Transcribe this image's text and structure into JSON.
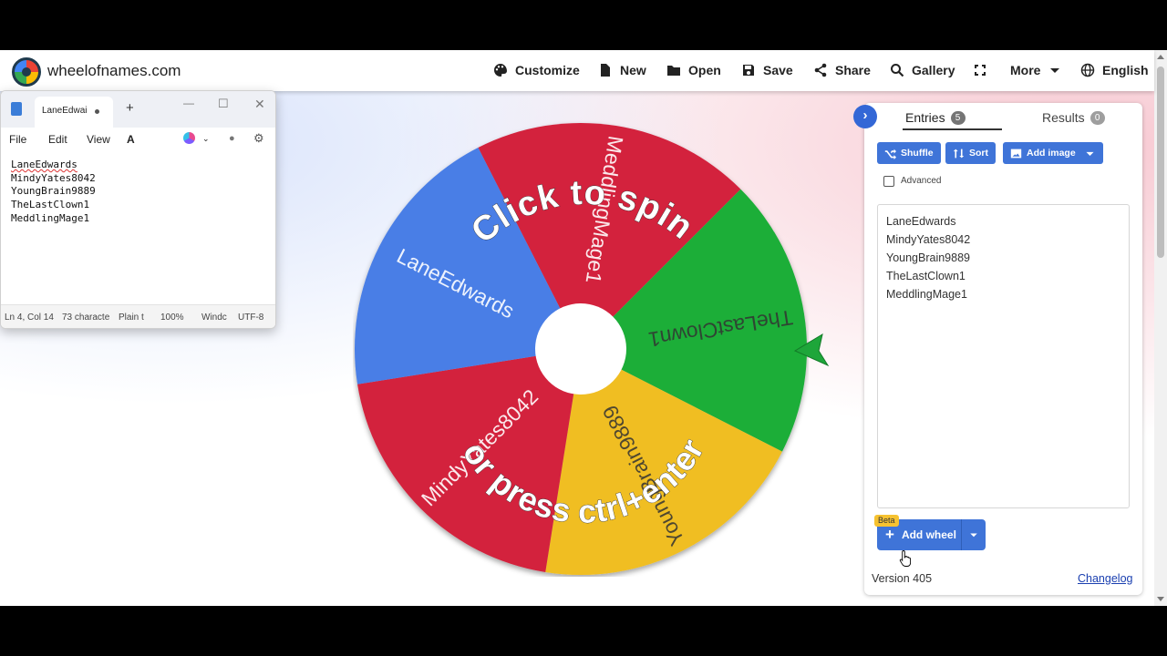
{
  "site": {
    "name": "wheelofnames.com"
  },
  "nav": [
    {
      "id": "customize",
      "label": "Customize",
      "icon": "palette-icon"
    },
    {
      "id": "new",
      "label": "New",
      "icon": "file-icon"
    },
    {
      "id": "open",
      "label": "Open",
      "icon": "folder-icon"
    },
    {
      "id": "save",
      "label": "Save",
      "icon": "floppy-icon"
    },
    {
      "id": "share",
      "label": "Share",
      "icon": "share-icon"
    },
    {
      "id": "gallery",
      "label": "Gallery",
      "icon": "search-icon"
    },
    {
      "id": "fullscreen",
      "label": "",
      "icon": "fullscreen-icon"
    },
    {
      "id": "more",
      "label": "More",
      "icon": "caret-down-icon"
    },
    {
      "id": "language",
      "label": "English",
      "icon": "globe-icon"
    }
  ],
  "notepad": {
    "tab_title": "LaneEdwai",
    "menu": [
      "File",
      "Edit",
      "View"
    ],
    "lines": [
      "LaneEdwards",
      "MindyYates8042",
      "YoungBrain9889",
      "TheLastClown1",
      "MeddlingMage1"
    ],
    "status": {
      "position": "Ln 4, Col 14",
      "chars": "73 characte",
      "format": "Plain t",
      "zoom": "100%",
      "eol": "Windc",
      "encoding": "UTF-8"
    }
  },
  "wheel": {
    "segments": [
      {
        "label": "MeddlingMage1",
        "color": "#d3223d"
      },
      {
        "label": "TheLastClown1",
        "color": "#1bae38"
      },
      {
        "label": "YoungBrain9889",
        "color": "#f0be22"
      },
      {
        "label": "MindyYates8042",
        "color": "#d3223d"
      },
      {
        "label": "LaneEdwards",
        "color": "#4a7ee6"
      }
    ],
    "spin_text_top": "Click to spin",
    "spin_text_bottom": "or press ctrl+enter",
    "pointer_color": "#1ea63a"
  },
  "panel": {
    "tabs": [
      {
        "label": "Entries",
        "count": "5"
      },
      {
        "label": "Results",
        "count": "0"
      }
    ],
    "buttons": {
      "shuffle": "Shuffle",
      "sort": "Sort",
      "add_image": "Add image"
    },
    "advanced_label": "Advanced",
    "entries": [
      "LaneEdwards",
      "MindyYates8042",
      "YoungBrain9889",
      "TheLastClown1",
      "MeddlingMage1"
    ],
    "beta": "Beta",
    "add_wheel": "Add wheel",
    "version": "Version 405",
    "changelog": "Changelog"
  },
  "colors": {
    "accent": "#3f74d8",
    "collapse": "#3367d6"
  }
}
